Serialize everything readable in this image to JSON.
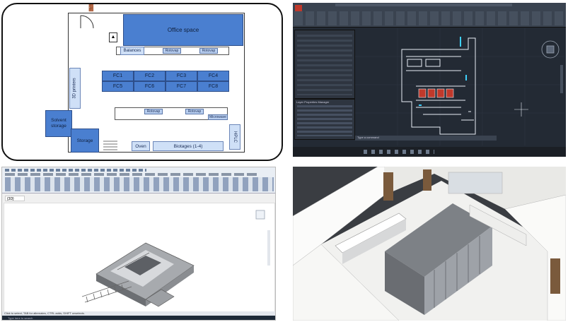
{
  "floorplan": {
    "office_space": "Office space",
    "balances": "Balances",
    "rotovap": "Rotovap",
    "printers_3d": "3D printers",
    "fume_cupboards": [
      "FC1",
      "FC2",
      "FC3",
      "FC4",
      "FC5",
      "FC6",
      "FC7",
      "FC8"
    ],
    "solvent_storage": "Solvent storage",
    "storage": "Storage",
    "microwave": "Microwave",
    "oven": "Oven",
    "biotages": "Biotages (1-4)",
    "hplc": "HPLC"
  },
  "cad": {
    "layer_panel_title": "Layer Properties Manager",
    "status_text": "Type a command"
  },
  "revit": {
    "view_tab": "{3D}",
    "status_text": "Click to select, TAB for alternates, CTRL adds, SHIFT unselects.",
    "search_text": "Type here to search"
  },
  "colors": {
    "blue": "#4a7fd0",
    "pale_blue": "#cfe0f7",
    "cad_bg": "#232a34",
    "cad_wall": "#e8eef6",
    "cad_red": "#c0392b"
  }
}
